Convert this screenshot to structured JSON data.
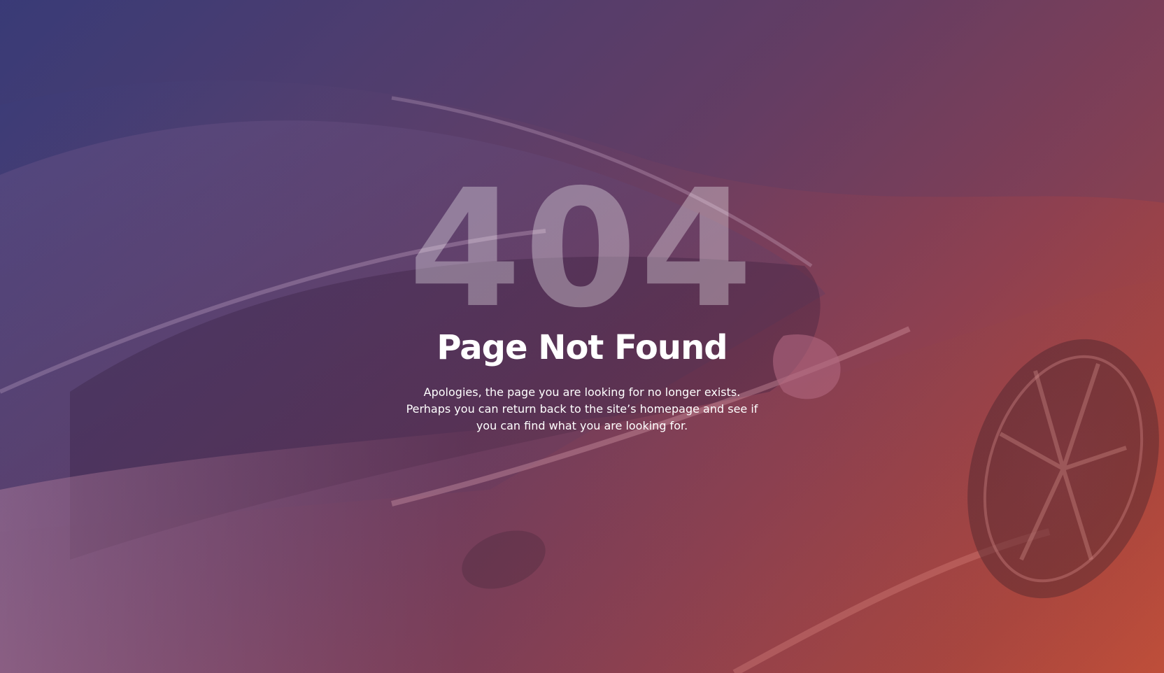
{
  "hero": {
    "error_code": "404",
    "title": "Page Not Found",
    "message": "Apologies, the page you are looking for no longer exists. Perhaps you can return back to the site’s homepage and see if you can find what you are looking for."
  },
  "colors": {
    "gradient_start": "#3c3f7a",
    "gradient_mid": "#6a3f62",
    "gradient_end": "#c2503a",
    "text": "#ffffff"
  },
  "background_image": "car-photo"
}
